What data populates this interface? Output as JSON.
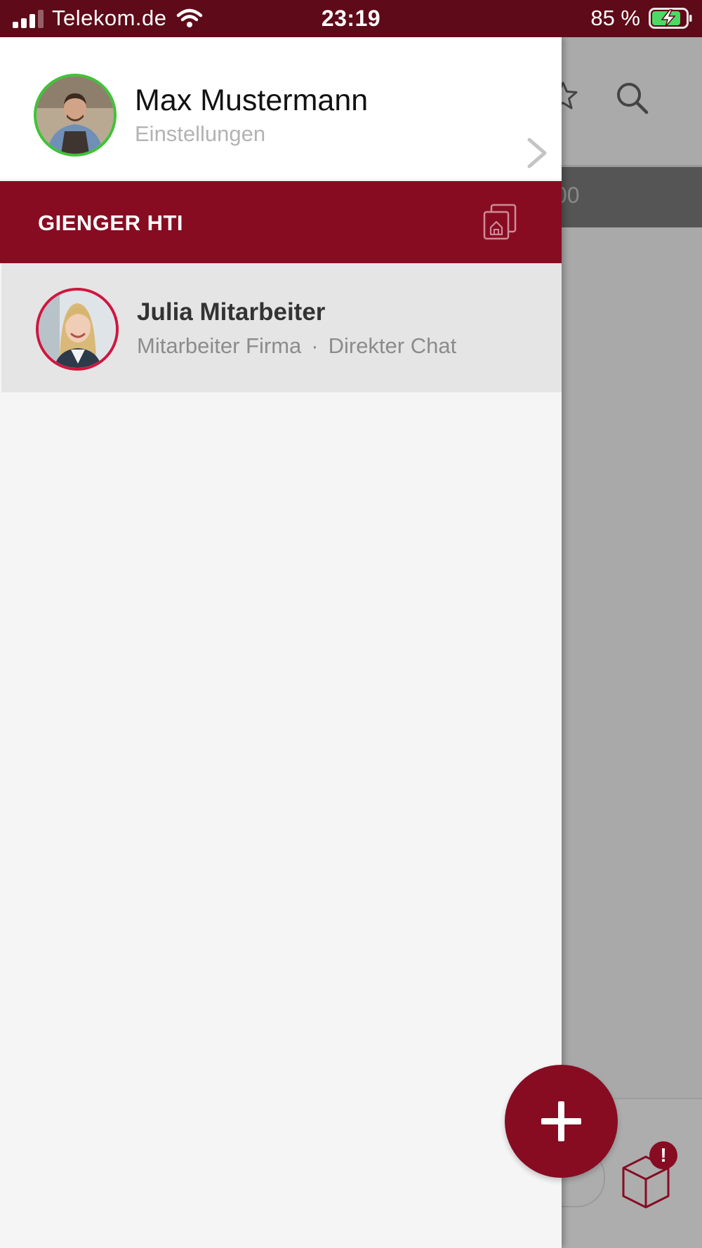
{
  "status_bar": {
    "carrier": "Telekom.de",
    "time": "23:19",
    "battery_percent": "85 %",
    "battery_level": 0.85,
    "signal_bars_active": 3,
    "signal_bars_total": 4
  },
  "profile": {
    "name": "Max Mustermann",
    "subtitle": "Einstellungen",
    "status_color": "#3fc337"
  },
  "company": {
    "name": "GIENGER HTI"
  },
  "chats": [
    {
      "name": "Julia Mitarbeiter",
      "role": "Mitarbeiter Firma",
      "separator": "·",
      "type": "Direkter Chat",
      "ring_color": "#d0163f"
    }
  ],
  "background": {
    "bar_text": "00",
    "notification_badge": "!"
  },
  "colors": {
    "brand": "#870c22",
    "status_bar": "#5e0a18"
  },
  "icons": {
    "add": "plus-icon",
    "search": "search-icon",
    "favorite": "star-icon",
    "company_switch": "company-switch-icon",
    "package": "package-icon"
  }
}
